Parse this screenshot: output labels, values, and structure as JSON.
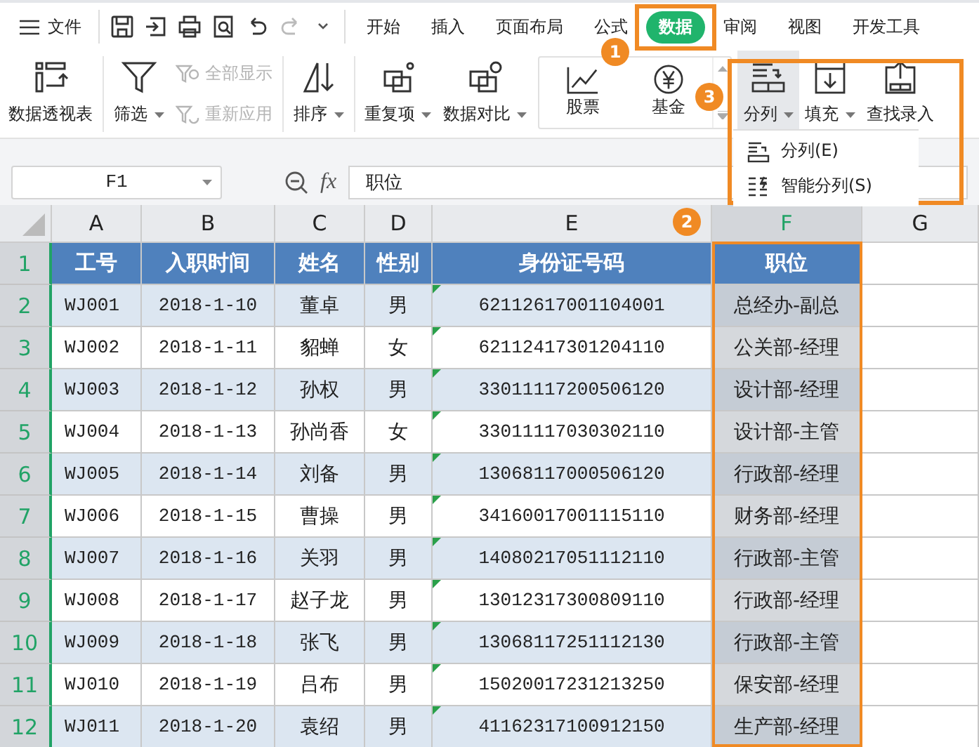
{
  "menu": {
    "file": "文件",
    "quick_access": [
      {
        "disabled": false
      },
      {
        "disabled": false
      },
      {
        "disabled": false
      },
      {
        "disabled": false
      },
      {
        "disabled": false
      },
      {
        "disabled": true
      }
    ],
    "tabs": [
      {
        "label": "开始",
        "selected": false
      },
      {
        "label": "插入",
        "selected": false
      },
      {
        "label": "页面布局",
        "selected": false
      },
      {
        "label": "公式",
        "selected": false
      },
      {
        "label": "数据",
        "selected": true
      },
      {
        "label": "审阅",
        "selected": false
      },
      {
        "label": "视图",
        "selected": false
      },
      {
        "label": "开发工具",
        "selected": false
      }
    ]
  },
  "ribbon": {
    "pivot": {
      "label": "数据透视表"
    },
    "filter": {
      "label": "筛选"
    },
    "show_all": {
      "label": "全部显示",
      "disabled": true
    },
    "reapply": {
      "label": "重新应用",
      "disabled": true
    },
    "sort": {
      "label": "排序"
    },
    "duplicates": {
      "label": "重复项"
    },
    "compare": {
      "label": "数据对比"
    },
    "gallery": [
      {
        "label": "股票"
      },
      {
        "label": "基金"
      }
    ],
    "split": {
      "label": "分列",
      "selected": true
    },
    "fill": {
      "label": "填充"
    },
    "lookup": {
      "label": "查找录入"
    }
  },
  "split_menu": [
    {
      "label": "分列(E)"
    },
    {
      "label": "智能分列(S)"
    }
  ],
  "callouts": [
    "1",
    "2",
    "3"
  ],
  "formula_bar": {
    "name_box": "F1",
    "fx": "fx",
    "formula": "职位"
  },
  "sheet": {
    "columns": [
      {
        "label": "A",
        "selected": false
      },
      {
        "label": "B",
        "selected": false
      },
      {
        "label": "C",
        "selected": false
      },
      {
        "label": "D",
        "selected": false
      },
      {
        "label": "E",
        "selected": false,
        "warning_marks": true
      },
      {
        "label": "F",
        "selected": true
      },
      {
        "label": "G",
        "selected": false
      }
    ],
    "row_numbers": [
      "1",
      "2",
      "3",
      "4",
      "5",
      "6",
      "7",
      "8",
      "9",
      "10",
      "11",
      "12"
    ],
    "header": [
      "工号",
      "入职时间",
      "姓名",
      "性别",
      "身份证号码",
      "职位"
    ],
    "rows": [
      [
        "WJ001",
        "2018-1-10",
        "董卓",
        "男",
        "62112617001104001",
        "总经办-副总"
      ],
      [
        "WJ002",
        "2018-1-11",
        "貂蝉",
        "女",
        "62112417301204110",
        "公关部-经理"
      ],
      [
        "WJ003",
        "2018-1-12",
        "孙权",
        "男",
        "33011117200506120",
        "设计部-经理"
      ],
      [
        "WJ004",
        "2018-1-13",
        "孙尚香",
        "女",
        "33011117030302110",
        "设计部-主管"
      ],
      [
        "WJ005",
        "2018-1-14",
        "刘备",
        "男",
        "13068117000506120",
        "行政部-经理"
      ],
      [
        "WJ006",
        "2018-1-15",
        "曹操",
        "男",
        "34160017001115110",
        "财务部-经理"
      ],
      [
        "WJ007",
        "2018-1-16",
        "关羽",
        "男",
        "14080217051112110",
        "行政部-主管"
      ],
      [
        "WJ008",
        "2018-1-17",
        "赵子龙",
        "男",
        "13012317300809110",
        "行政部-经理"
      ],
      [
        "WJ009",
        "2018-1-18",
        "张飞",
        "男",
        "13068117251112130",
        "行政部-主管"
      ],
      [
        "WJ010",
        "2018-1-19",
        "吕布",
        "男",
        "15020017231213250",
        "保安部-经理"
      ],
      [
        "WJ011",
        "2018-1-20",
        "袁绍",
        "男",
        "41162317100912150",
        "生产部-经理"
      ]
    ]
  }
}
